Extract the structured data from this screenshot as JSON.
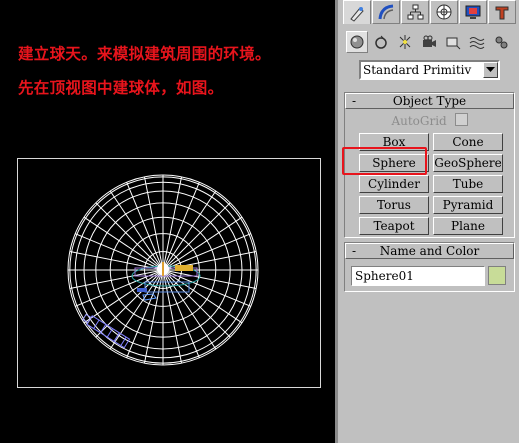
{
  "captions": {
    "line1": "建立球天。来模拟建筑周围的环境。",
    "line2": "先在顶视图中建球体，如图。"
  },
  "command_panel": {
    "tabs": [
      "create-icon",
      "modify-icon",
      "hierarchy-icon",
      "motion-icon",
      "display-icon",
      "utilities-icon"
    ],
    "subcategories": [
      "geometry-icon",
      "shapes-icon",
      "lights-icon",
      "cameras-icon",
      "helpers-icon",
      "space-warps-icon",
      "systems-icon"
    ],
    "dropdown": {
      "value": "Standard Primitiv"
    },
    "object_type": {
      "title": "Object Type",
      "collapse": "-",
      "autogrid": "AutoGrid",
      "buttons": [
        "Box",
        "Cone",
        "Sphere",
        "GeoSphere",
        "Cylinder",
        "Tube",
        "Torus",
        "Pyramid",
        "Teapot",
        "Plane"
      ],
      "highlighted": "Sphere"
    },
    "name_and_color": {
      "title": "Name and Color",
      "collapse": "-",
      "name_value": "Sphere01",
      "color": "#c8dc98"
    }
  },
  "colors": {
    "caption": "#e8141c",
    "highlight": "#e8141c",
    "panel_bg": "#c0c0c0",
    "viewport_bg": "#000000",
    "wireframe": "#ffffff"
  }
}
